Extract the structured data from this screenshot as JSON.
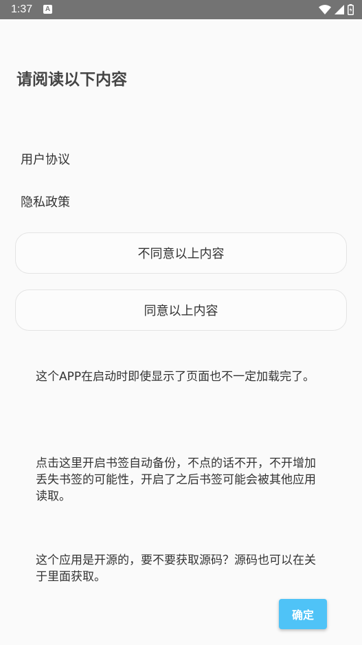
{
  "status_bar": {
    "time": "1:37",
    "app_icon_letter": "A",
    "icons": [
      "wifi-icon",
      "cellular-signal-icon",
      "battery-icon"
    ]
  },
  "page": {
    "title": "请阅读以下内容"
  },
  "links": {
    "user_agreement": "用户协议",
    "privacy_policy": "隐私政策"
  },
  "buttons": {
    "disagree": "不同意以上内容",
    "agree": "同意以上内容",
    "confirm": "确定"
  },
  "notices": {
    "loading": "这个APP在启动时即使显示了页面也不一定加载完了。",
    "backup": "点击这里开启书签自动备份，不点的话不开，不开增加丢失书签的可能性，开启了之后书签可能会被其他应用读取。",
    "open_source": "这个应用是开源的，要不要获取源码？源码也可以在关于里面获取。"
  },
  "colors": {
    "status_bar": "#737373",
    "background": "#fafafa",
    "confirm_button": "#4fc3f7",
    "button_border": "#e4e4e4"
  }
}
